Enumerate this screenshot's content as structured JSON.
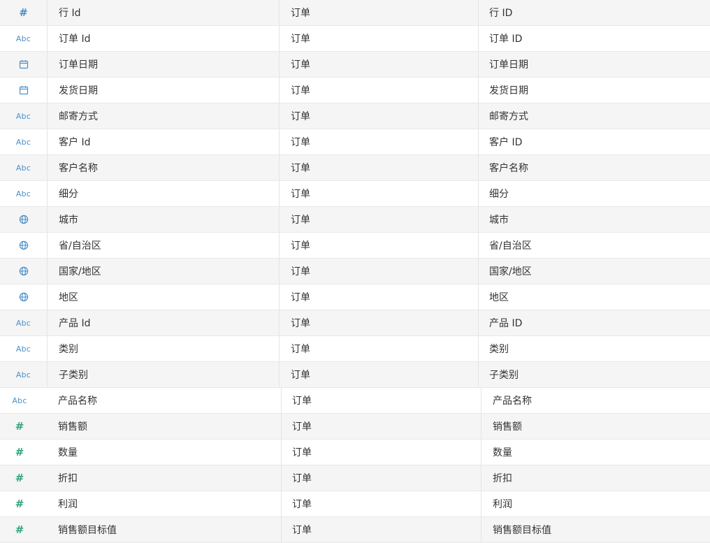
{
  "colors": {
    "type_icon_blue": "#4a90c9",
    "type_icon_green": "#2fa67a",
    "row_alt_bg": "#f5f5f5"
  },
  "rows": [
    {
      "icon": "number-icon",
      "name": "行 Id",
      "table": "订单",
      "remote": "行 ID"
    },
    {
      "icon": "string-icon",
      "name": "订单 Id",
      "table": "订单",
      "remote": "订单 ID"
    },
    {
      "icon": "date-icon",
      "name": "订单日期",
      "table": "订单",
      "remote": "订单日期"
    },
    {
      "icon": "date-icon",
      "name": "发货日期",
      "table": "订单",
      "remote": "发货日期"
    },
    {
      "icon": "string-icon",
      "name": "邮寄方式",
      "table": "订单",
      "remote": "邮寄方式"
    },
    {
      "icon": "string-icon",
      "name": "客户 Id",
      "table": "订单",
      "remote": "客户 ID"
    },
    {
      "icon": "string-icon",
      "name": "客户名称",
      "table": "订单",
      "remote": "客户名称"
    },
    {
      "icon": "string-icon",
      "name": "细分",
      "table": "订单",
      "remote": "细分"
    },
    {
      "icon": "geo-icon",
      "name": "城市",
      "table": "订单",
      "remote": "城市"
    },
    {
      "icon": "geo-icon",
      "name": "省/自治区",
      "table": "订单",
      "remote": "省/自治区"
    },
    {
      "icon": "geo-icon",
      "name": "国家/地区",
      "table": "订单",
      "remote": "国家/地区"
    },
    {
      "icon": "geo-icon",
      "name": "地区",
      "table": "订单",
      "remote": "地区"
    },
    {
      "icon": "string-icon",
      "name": "产品 Id",
      "table": "订单",
      "remote": "产品 ID"
    },
    {
      "icon": "string-icon",
      "name": "类别",
      "table": "订单",
      "remote": "类别"
    },
    {
      "icon": "string-icon",
      "name": "子类别",
      "table": "订单",
      "remote": "子类别"
    },
    {
      "icon": "string-icon",
      "name": "产品名称",
      "table": "订单",
      "remote": "产品名称"
    },
    {
      "icon": "number-icon",
      "name": "销售额",
      "table": "订单",
      "remote": "销售额"
    },
    {
      "icon": "number-icon",
      "name": "数量",
      "table": "订单",
      "remote": "数量"
    },
    {
      "icon": "number-icon",
      "name": "折扣",
      "table": "订单",
      "remote": "折扣"
    },
    {
      "icon": "number-icon",
      "name": "利润",
      "table": "订单",
      "remote": "利润"
    },
    {
      "icon": "number-icon",
      "name": "销售额目标值",
      "table": "订单",
      "remote": "销售额目标值"
    }
  ]
}
